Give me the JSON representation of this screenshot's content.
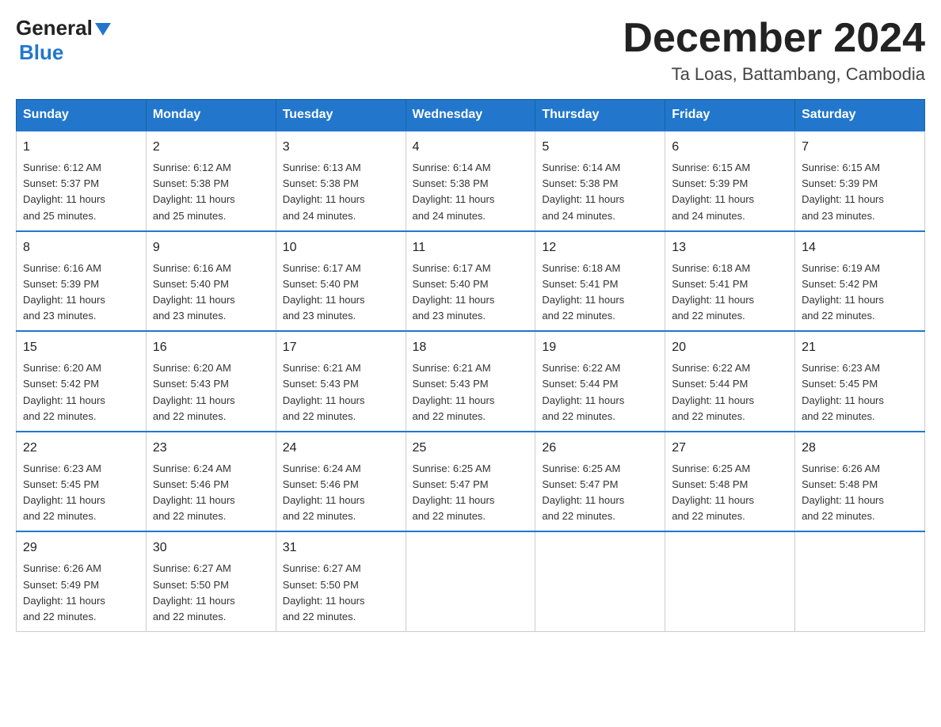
{
  "header": {
    "logo_general": "General",
    "logo_blue": "Blue",
    "month_title": "December 2024",
    "location": "Ta Loas, Battambang, Cambodia"
  },
  "days_of_week": [
    "Sunday",
    "Monday",
    "Tuesday",
    "Wednesday",
    "Thursday",
    "Friday",
    "Saturday"
  ],
  "weeks": [
    [
      {
        "day": "1",
        "sunrise": "6:12 AM",
        "sunset": "5:37 PM",
        "daylight": "11 hours and 25 minutes."
      },
      {
        "day": "2",
        "sunrise": "6:12 AM",
        "sunset": "5:38 PM",
        "daylight": "11 hours and 25 minutes."
      },
      {
        "day": "3",
        "sunrise": "6:13 AM",
        "sunset": "5:38 PM",
        "daylight": "11 hours and 24 minutes."
      },
      {
        "day": "4",
        "sunrise": "6:14 AM",
        "sunset": "5:38 PM",
        "daylight": "11 hours and 24 minutes."
      },
      {
        "day": "5",
        "sunrise": "6:14 AM",
        "sunset": "5:38 PM",
        "daylight": "11 hours and 24 minutes."
      },
      {
        "day": "6",
        "sunrise": "6:15 AM",
        "sunset": "5:39 PM",
        "daylight": "11 hours and 24 minutes."
      },
      {
        "day": "7",
        "sunrise": "6:15 AM",
        "sunset": "5:39 PM",
        "daylight": "11 hours and 23 minutes."
      }
    ],
    [
      {
        "day": "8",
        "sunrise": "6:16 AM",
        "sunset": "5:39 PM",
        "daylight": "11 hours and 23 minutes."
      },
      {
        "day": "9",
        "sunrise": "6:16 AM",
        "sunset": "5:40 PM",
        "daylight": "11 hours and 23 minutes."
      },
      {
        "day": "10",
        "sunrise": "6:17 AM",
        "sunset": "5:40 PM",
        "daylight": "11 hours and 23 minutes."
      },
      {
        "day": "11",
        "sunrise": "6:17 AM",
        "sunset": "5:40 PM",
        "daylight": "11 hours and 23 minutes."
      },
      {
        "day": "12",
        "sunrise": "6:18 AM",
        "sunset": "5:41 PM",
        "daylight": "11 hours and 22 minutes."
      },
      {
        "day": "13",
        "sunrise": "6:18 AM",
        "sunset": "5:41 PM",
        "daylight": "11 hours and 22 minutes."
      },
      {
        "day": "14",
        "sunrise": "6:19 AM",
        "sunset": "5:42 PM",
        "daylight": "11 hours and 22 minutes."
      }
    ],
    [
      {
        "day": "15",
        "sunrise": "6:20 AM",
        "sunset": "5:42 PM",
        "daylight": "11 hours and 22 minutes."
      },
      {
        "day": "16",
        "sunrise": "6:20 AM",
        "sunset": "5:43 PM",
        "daylight": "11 hours and 22 minutes."
      },
      {
        "day": "17",
        "sunrise": "6:21 AM",
        "sunset": "5:43 PM",
        "daylight": "11 hours and 22 minutes."
      },
      {
        "day": "18",
        "sunrise": "6:21 AM",
        "sunset": "5:43 PM",
        "daylight": "11 hours and 22 minutes."
      },
      {
        "day": "19",
        "sunrise": "6:22 AM",
        "sunset": "5:44 PM",
        "daylight": "11 hours and 22 minutes."
      },
      {
        "day": "20",
        "sunrise": "6:22 AM",
        "sunset": "5:44 PM",
        "daylight": "11 hours and 22 minutes."
      },
      {
        "day": "21",
        "sunrise": "6:23 AM",
        "sunset": "5:45 PM",
        "daylight": "11 hours and 22 minutes."
      }
    ],
    [
      {
        "day": "22",
        "sunrise": "6:23 AM",
        "sunset": "5:45 PM",
        "daylight": "11 hours and 22 minutes."
      },
      {
        "day": "23",
        "sunrise": "6:24 AM",
        "sunset": "5:46 PM",
        "daylight": "11 hours and 22 minutes."
      },
      {
        "day": "24",
        "sunrise": "6:24 AM",
        "sunset": "5:46 PM",
        "daylight": "11 hours and 22 minutes."
      },
      {
        "day": "25",
        "sunrise": "6:25 AM",
        "sunset": "5:47 PM",
        "daylight": "11 hours and 22 minutes."
      },
      {
        "day": "26",
        "sunrise": "6:25 AM",
        "sunset": "5:47 PM",
        "daylight": "11 hours and 22 minutes."
      },
      {
        "day": "27",
        "sunrise": "6:25 AM",
        "sunset": "5:48 PM",
        "daylight": "11 hours and 22 minutes."
      },
      {
        "day": "28",
        "sunrise": "6:26 AM",
        "sunset": "5:48 PM",
        "daylight": "11 hours and 22 minutes."
      }
    ],
    [
      {
        "day": "29",
        "sunrise": "6:26 AM",
        "sunset": "5:49 PM",
        "daylight": "11 hours and 22 minutes."
      },
      {
        "day": "30",
        "sunrise": "6:27 AM",
        "sunset": "5:50 PM",
        "daylight": "11 hours and 22 minutes."
      },
      {
        "day": "31",
        "sunrise": "6:27 AM",
        "sunset": "5:50 PM",
        "daylight": "11 hours and 22 minutes."
      },
      null,
      null,
      null,
      null
    ]
  ],
  "labels": {
    "sunrise": "Sunrise:",
    "sunset": "Sunset:",
    "daylight": "Daylight:"
  }
}
